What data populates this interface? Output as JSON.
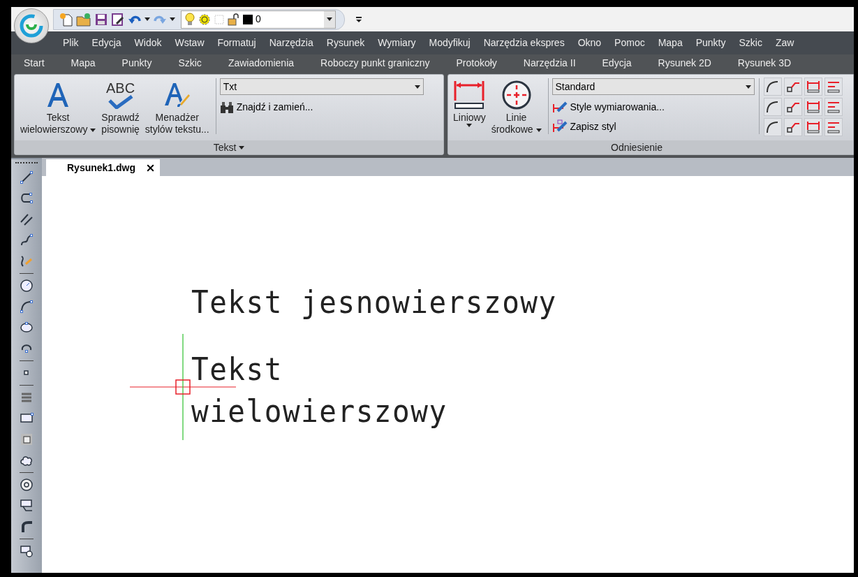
{
  "quick_access": {
    "layer_value": "0"
  },
  "menu": [
    "Plik",
    "Edycja",
    "Widok",
    "Wstaw",
    "Formatuj",
    "Narzędzia",
    "Rysunek",
    "Wymiary",
    "Modyfikuj",
    "Narzędzia ekspres",
    "Okno",
    "Pomoc",
    "Mapa",
    "Punkty",
    "Szkic",
    "Zaw"
  ],
  "ribbon_tabs": [
    "Start",
    "Mapa",
    "Punkty",
    "Szkic",
    "Zawiadomienia",
    "Roboczy punkt graniczny",
    "Protokoły",
    "Narzędzia II",
    "Edycja",
    "Rysunek 2D",
    "Rysunek 3D"
  ],
  "text_panel": {
    "title": "Tekst",
    "buttons": [
      {
        "kind": "text",
        "lines": [
          "Tekst",
          "wielowierszowy"
        ],
        "has_menu": true
      },
      {
        "kind": "spell",
        "icon_text": "ABC",
        "lines": [
          "Sprawdź",
          "pisownię"
        ],
        "has_menu": false
      },
      {
        "kind": "style",
        "lines": [
          "Menadżer",
          "stylów tekstu..."
        ],
        "has_menu": false
      }
    ],
    "style_value": "Txt",
    "find_label": "Znajdź i zamień..."
  },
  "dim_panel": {
    "title": "Odniesienie",
    "buttons": [
      {
        "kind": "linear",
        "lines": [
          "Liniowy"
        ],
        "has_menu": true,
        "menu_below": true
      },
      {
        "kind": "center",
        "lines": [
          "Linie",
          "środkowe"
        ],
        "has_menu": true,
        "menu_below": false
      }
    ],
    "style_value": "Standard",
    "links": [
      "Style wymiarowania...",
      "Zapisz styl"
    ]
  },
  "document_tabs": [
    {
      "label": "Rysunek1.dwg",
      "selected": true
    }
  ],
  "drawing": {
    "single_line_text": "Tekst jesnowierszowy",
    "multiline_text": [
      "Tekst",
      "wielowierszowy"
    ]
  }
}
